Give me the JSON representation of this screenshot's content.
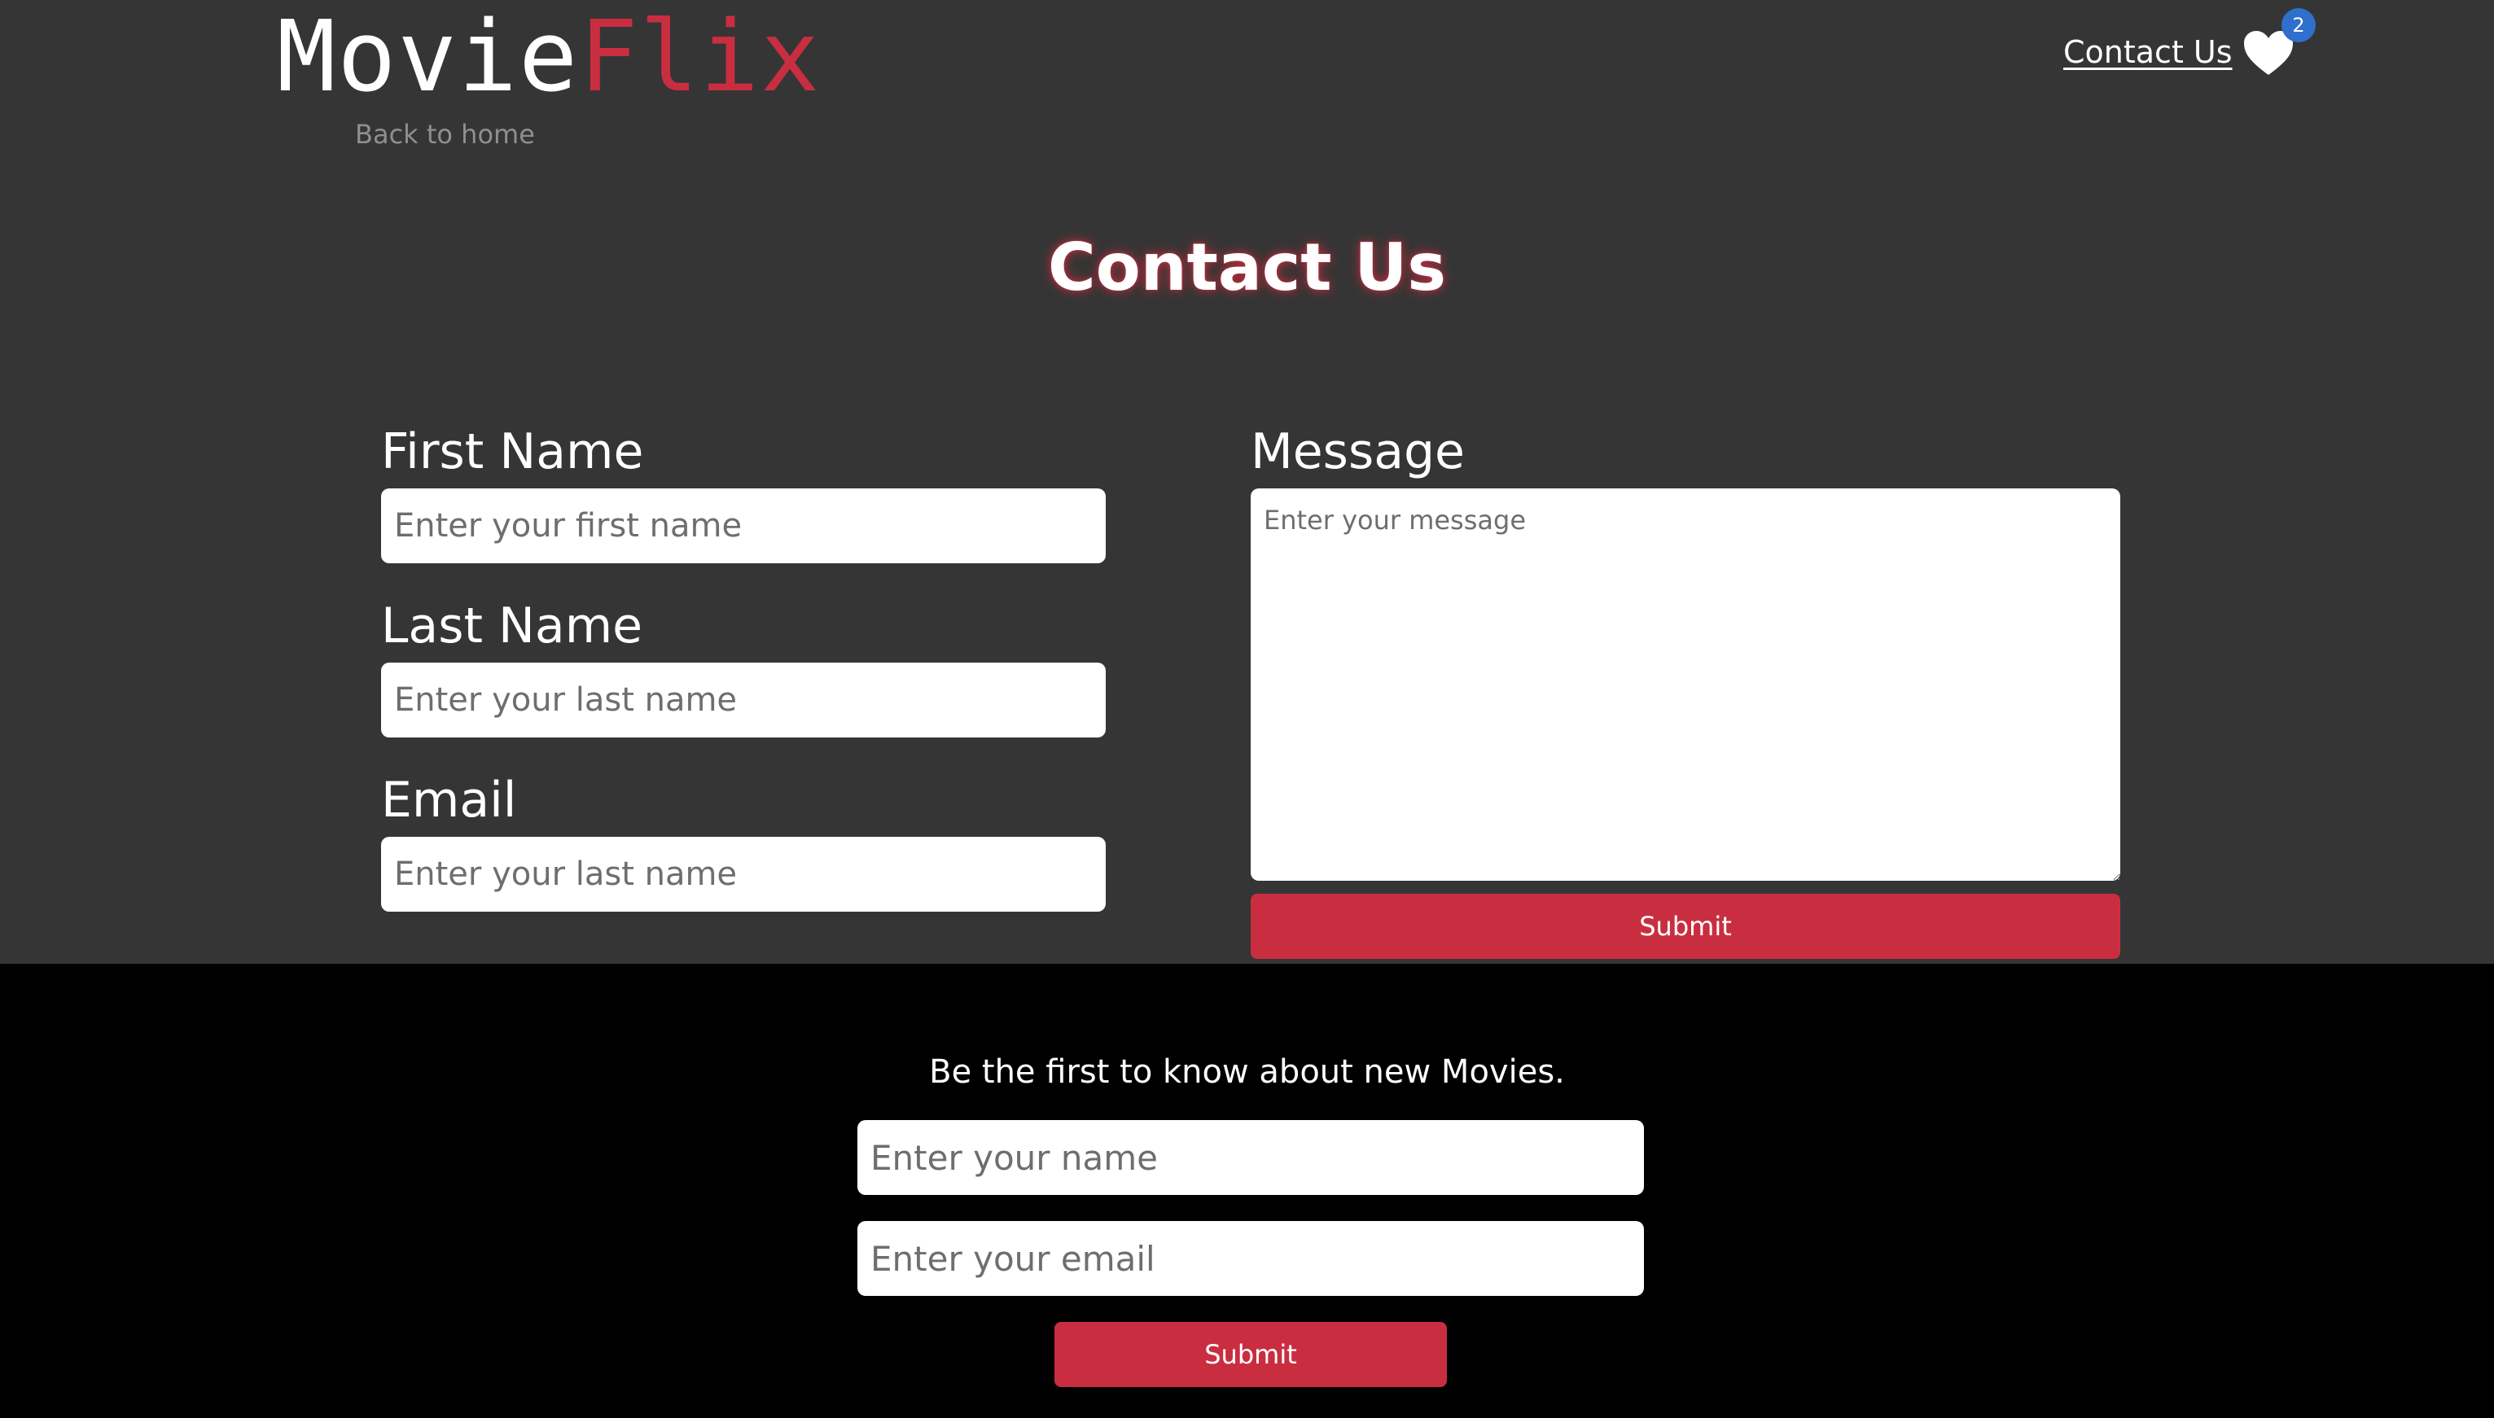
{
  "header": {
    "logo_part1": "Movie",
    "logo_part2": "Flix",
    "back_link": "Back to home",
    "nav_contact": "Contact Us",
    "favorites_count": "2"
  },
  "page_title": "Contact Us",
  "form": {
    "first_name_label": "First Name",
    "first_name_placeholder": "Enter your first name",
    "last_name_label": "Last Name",
    "last_name_placeholder": "Enter your last name",
    "email_label": "Email",
    "email_placeholder": "Enter your last name",
    "message_label": "Message",
    "message_placeholder": "Enter your message",
    "submit_label": "Submit"
  },
  "footer": {
    "title": "Be the first to know about new Movies.",
    "name_placeholder": "Enter your name",
    "email_placeholder": "Enter your email",
    "submit_label": "Submit"
  },
  "colors": {
    "background": "#353535",
    "accent": "#c92e40",
    "footer": "#000000",
    "badge": "#2f6fce"
  }
}
